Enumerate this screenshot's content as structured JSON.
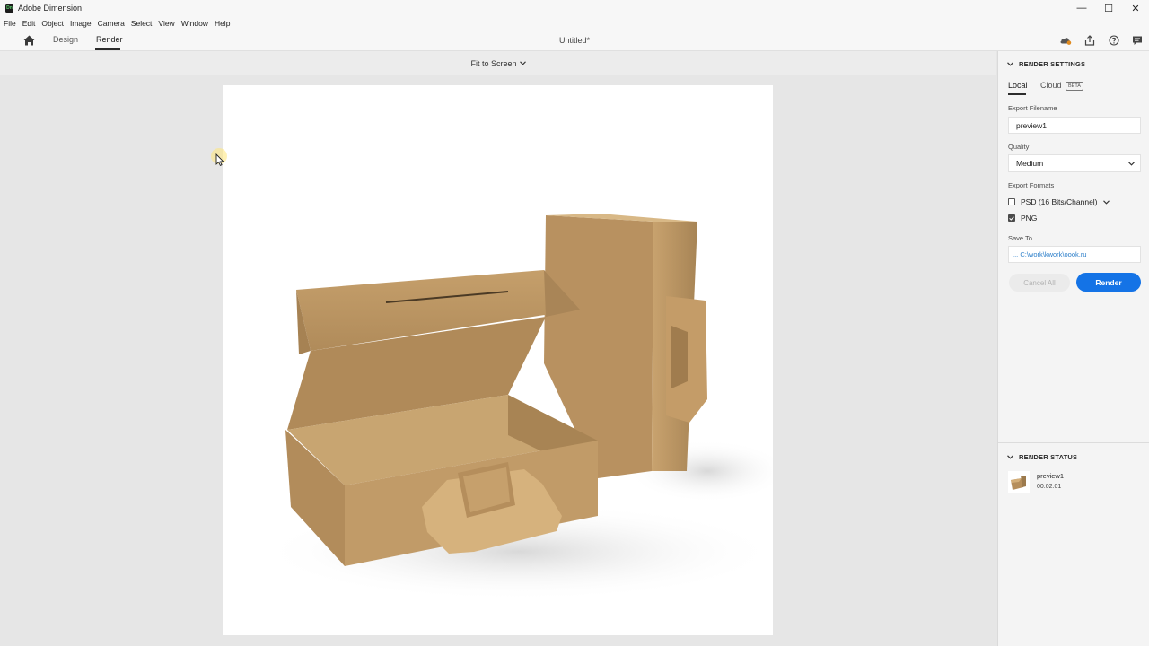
{
  "window": {
    "app_title": "Adobe Dimension",
    "logo_text": "Dn",
    "controls": [
      "—",
      "☐",
      "✕"
    ]
  },
  "menu": [
    "File",
    "Edit",
    "Object",
    "Image",
    "Camera",
    "Select",
    "View",
    "Window",
    "Help"
  ],
  "header": {
    "tabs": [
      "Design",
      "Render"
    ],
    "active_tab": "Render",
    "document_title": "Untitled*",
    "icons": [
      "cloud-sync-icon",
      "share-icon",
      "help-icon",
      "feedback-icon"
    ]
  },
  "canvas": {
    "zoom_label": "Fit to Screen"
  },
  "render_settings": {
    "section_title": "RENDER SETTINGS",
    "tabs": {
      "local": "Local",
      "cloud": "Cloud",
      "beta": "BETA"
    },
    "export_filename_label": "Export Filename",
    "export_filename": "preview1",
    "quality_label": "Quality",
    "quality": "Medium",
    "export_formats_label": "Export Formats",
    "formats": [
      {
        "label": "PSD (16 Bits/Channel)",
        "checked": false
      },
      {
        "label": "PNG",
        "checked": true
      }
    ],
    "save_to_label": "Save To",
    "save_to_path": "... C:\\work\\kwork\\oook.ru",
    "cancel_label": "Cancel All",
    "render_label": "Render"
  },
  "render_status": {
    "section_title": "RENDER STATUS",
    "item_name": "preview1",
    "item_time": "00:02:01"
  },
  "colors": {
    "accent": "#1473e6",
    "panel_bg": "#f4f4f4",
    "canvas_bg": "#e6e6e6",
    "cardboard": "#c9a473"
  }
}
